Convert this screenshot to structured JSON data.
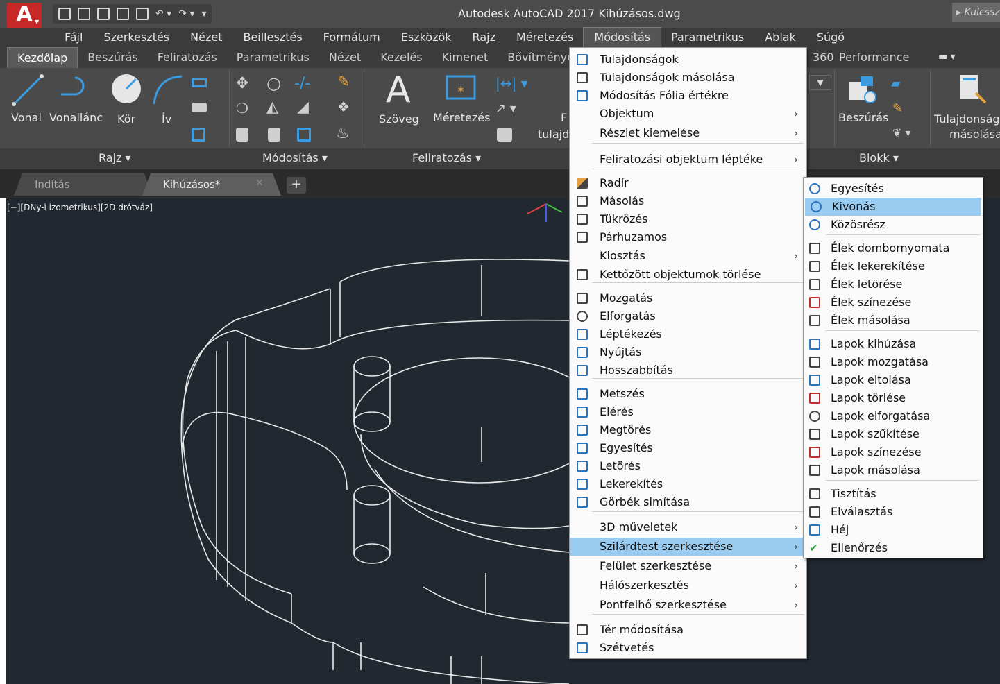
{
  "titlebar": {
    "app_letter": "A",
    "title": "Autodesk AutoCAD 2017   Kihúzásos.dwg",
    "search": "Kulcssz"
  },
  "menubar": [
    "Fájl",
    "Szerkesztés",
    "Nézet",
    "Beillesztés",
    "Formátum",
    "Eszközök",
    "Rajz",
    "Méretezés",
    "Módosítás",
    "Parametrikus",
    "Ablak",
    "Súgó"
  ],
  "menubar_active": 8,
  "ribbon_tabs": [
    "Kezdőlap",
    "Beszúrás",
    "Feliratozás",
    "Parametrikus",
    "Nézet",
    "Kezelés",
    "Kimenet",
    "Bővítmények"
  ],
  "ribbon_tabs_right": [
    "360",
    "Performance"
  ],
  "ribbon": {
    "vonal": "Vonal",
    "vonallanc": "Vonallánc",
    "kor": "Kör",
    "iv": "Ív",
    "szoveg": "Szöveg",
    "meretezes": "Méretezés",
    "foliatul_f": "F",
    "foliatul_2": "tulajd",
    "beszuras": "Beszúrás",
    "tulajdonsag_1": "Tulajdonság",
    "tulajdonsag_2": "másolása",
    "panels": {
      "rajz": "Rajz ▾",
      "modositas": "Módosítás ▾",
      "feliratozas": "Feliratozás ▾",
      "blokk": "Blokk ▾"
    }
  },
  "doc_tabs": {
    "start": "Indítás",
    "file": "Kihúzásos*",
    "close": "✕",
    "plus": "+"
  },
  "viewport_label": "[−][DNy-i izometrikus][2D drótváz]",
  "main_menu": [
    {
      "label": "Tulajdonságok",
      "icon": "properties-icon"
    },
    {
      "label": "Tulajdonságok másolása",
      "icon": "match-properties-icon"
    },
    {
      "label": "Módosítás Fólia értékre",
      "icon": "layer-value-icon"
    },
    {
      "label": "Objektum",
      "arrow": true
    },
    {
      "label": "Részlet kiemelése",
      "arrow": true
    },
    {
      "label": "Feliratozási objektum léptéke",
      "arrow": true
    },
    {
      "label": "Radír",
      "icon": "eraser-icon"
    },
    {
      "label": "Másolás",
      "icon": "copy-icon"
    },
    {
      "label": "Tükrözés",
      "icon": "mirror-icon"
    },
    {
      "label": "Párhuzamos",
      "icon": "offset-icon"
    },
    {
      "label": "Kiosztás",
      "arrow": true
    },
    {
      "label": "Kettőzött objektumok törlése",
      "icon": "delete-duplicates-icon"
    },
    {
      "label": "Mozgatás",
      "icon": "move-icon"
    },
    {
      "label": "Elforgatás",
      "icon": "rotate-icon"
    },
    {
      "label": "Léptékezés",
      "icon": "scale-icon"
    },
    {
      "label": "Nyújtás",
      "icon": "stretch-icon"
    },
    {
      "label": "Hosszabbítás",
      "icon": "lengthen-icon"
    },
    {
      "label": "Metszés",
      "icon": "trim-icon"
    },
    {
      "label": "Elérés",
      "icon": "extend-icon"
    },
    {
      "label": "Megtörés",
      "icon": "break-icon"
    },
    {
      "label": "Egyesítés",
      "icon": "join-icon"
    },
    {
      "label": "Letörés",
      "icon": "chamfer-icon"
    },
    {
      "label": "Lekerekítés",
      "icon": "fillet-icon"
    },
    {
      "label": "Görbék simítása",
      "icon": "blend-curves-icon"
    },
    {
      "label": "3D műveletek",
      "arrow": true
    },
    {
      "label": "Szilárdtest szerkesztése",
      "arrow": true,
      "highlight": true
    },
    {
      "label": "Felület szerkesztése",
      "arrow": true
    },
    {
      "label": "Hálószerkesztés",
      "arrow": true
    },
    {
      "label": "Pontfelhő szerkesztése",
      "arrow": true
    },
    {
      "label": "Tér módosítása",
      "icon": "modify-space-icon"
    },
    {
      "label": "Szétvetés",
      "icon": "explode-icon"
    }
  ],
  "sub_menu": [
    {
      "label": "Egyesítés",
      "icon": "union-icon"
    },
    {
      "label": "Kivonás",
      "icon": "subtract-icon",
      "highlight": true
    },
    {
      "label": "Közösrész",
      "icon": "intersect-icon"
    },
    {
      "label": "Élek dombornyomata",
      "icon": "imprint-edges-icon"
    },
    {
      "label": "Élek lekerekítése",
      "icon": "fillet-edges-icon"
    },
    {
      "label": "Élek letörése",
      "icon": "chamfer-edges-icon"
    },
    {
      "label": "Élek színezése",
      "icon": "color-edges-icon"
    },
    {
      "label": "Élek másolása",
      "icon": "copy-edges-icon"
    },
    {
      "label": "Lapok kihúzása",
      "icon": "extrude-faces-icon"
    },
    {
      "label": "Lapok mozgatása",
      "icon": "move-faces-icon"
    },
    {
      "label": "Lapok eltolása",
      "icon": "offset-faces-icon"
    },
    {
      "label": "Lapok törlése",
      "icon": "delete-faces-icon"
    },
    {
      "label": "Lapok elforgatása",
      "icon": "rotate-faces-icon"
    },
    {
      "label": "Lapok szűkítése",
      "icon": "taper-faces-icon"
    },
    {
      "label": "Lapok színezése",
      "icon": "color-faces-icon"
    },
    {
      "label": "Lapok másolása",
      "icon": "copy-faces-icon"
    },
    {
      "label": "Tisztítás",
      "icon": "clean-icon"
    },
    {
      "label": "Elválasztás",
      "icon": "separate-icon"
    },
    {
      "label": "Héj",
      "icon": "shell-icon"
    },
    {
      "label": "Ellenőrzés",
      "icon": "check-icon"
    }
  ],
  "colors": {
    "accent_blue": "#3a9be0",
    "highlight": "#99cbf0",
    "app_red": "#c62828",
    "viewport": "#212830"
  }
}
